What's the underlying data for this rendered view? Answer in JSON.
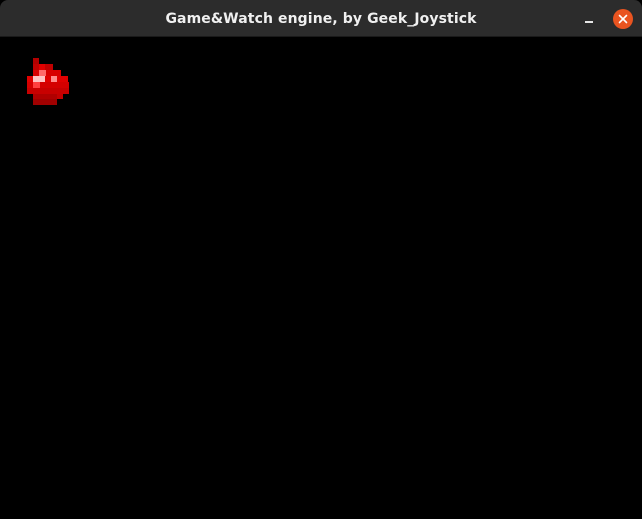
{
  "window": {
    "title": "Game&Watch engine, by Geek_Joystick",
    "minimize_icon": "minimize-icon",
    "close_icon": "close-icon",
    "close_color": "#e95420",
    "titlebar_color": "#2c2c2c"
  },
  "game": {
    "background_color": "#000000",
    "sprite_icon": "red-gem-icon",
    "sprite_colors": {
      "dark_red": "#b20000",
      "red": "#e00000",
      "highlight": "#ff8c8c",
      "shine": "#ffd6d6"
    }
  }
}
